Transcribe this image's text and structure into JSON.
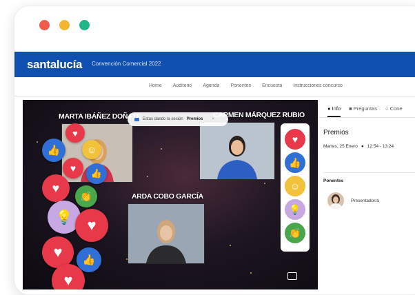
{
  "window": {
    "dots": [
      "#f25b4b",
      "#f5b62f",
      "#22b585"
    ]
  },
  "header": {
    "brand": "santalucía",
    "event": "Convención Comercial 2022",
    "accent": "#0f4fb0"
  },
  "nav": {
    "items": [
      "Home",
      "Auditorio",
      "Agenda",
      "Ponentes",
      "Encuesta",
      "Instrucciones concurso"
    ]
  },
  "stage": {
    "session_label": "Estas dando la sesión",
    "session_name": "Premios",
    "speakers": [
      {
        "name": "MARTA IBÁÑEZ DOÑATE"
      },
      {
        "name": "CARMEN MÁRQUEZ RUBIO"
      },
      {
        "name": "ARDA COBO GARCÍA"
      }
    ],
    "reactions": [
      "heart-icon",
      "like-icon",
      "smile-icon",
      "bulb-icon",
      "clap-icon"
    ]
  },
  "panel": {
    "tabs": [
      "Info",
      "Preguntas",
      "Cone"
    ],
    "title": "Premios",
    "date": "Martes, 25 Enero",
    "time": "12:54 - 13:24",
    "section": "Ponentes",
    "speaker": "Presentador/a"
  }
}
